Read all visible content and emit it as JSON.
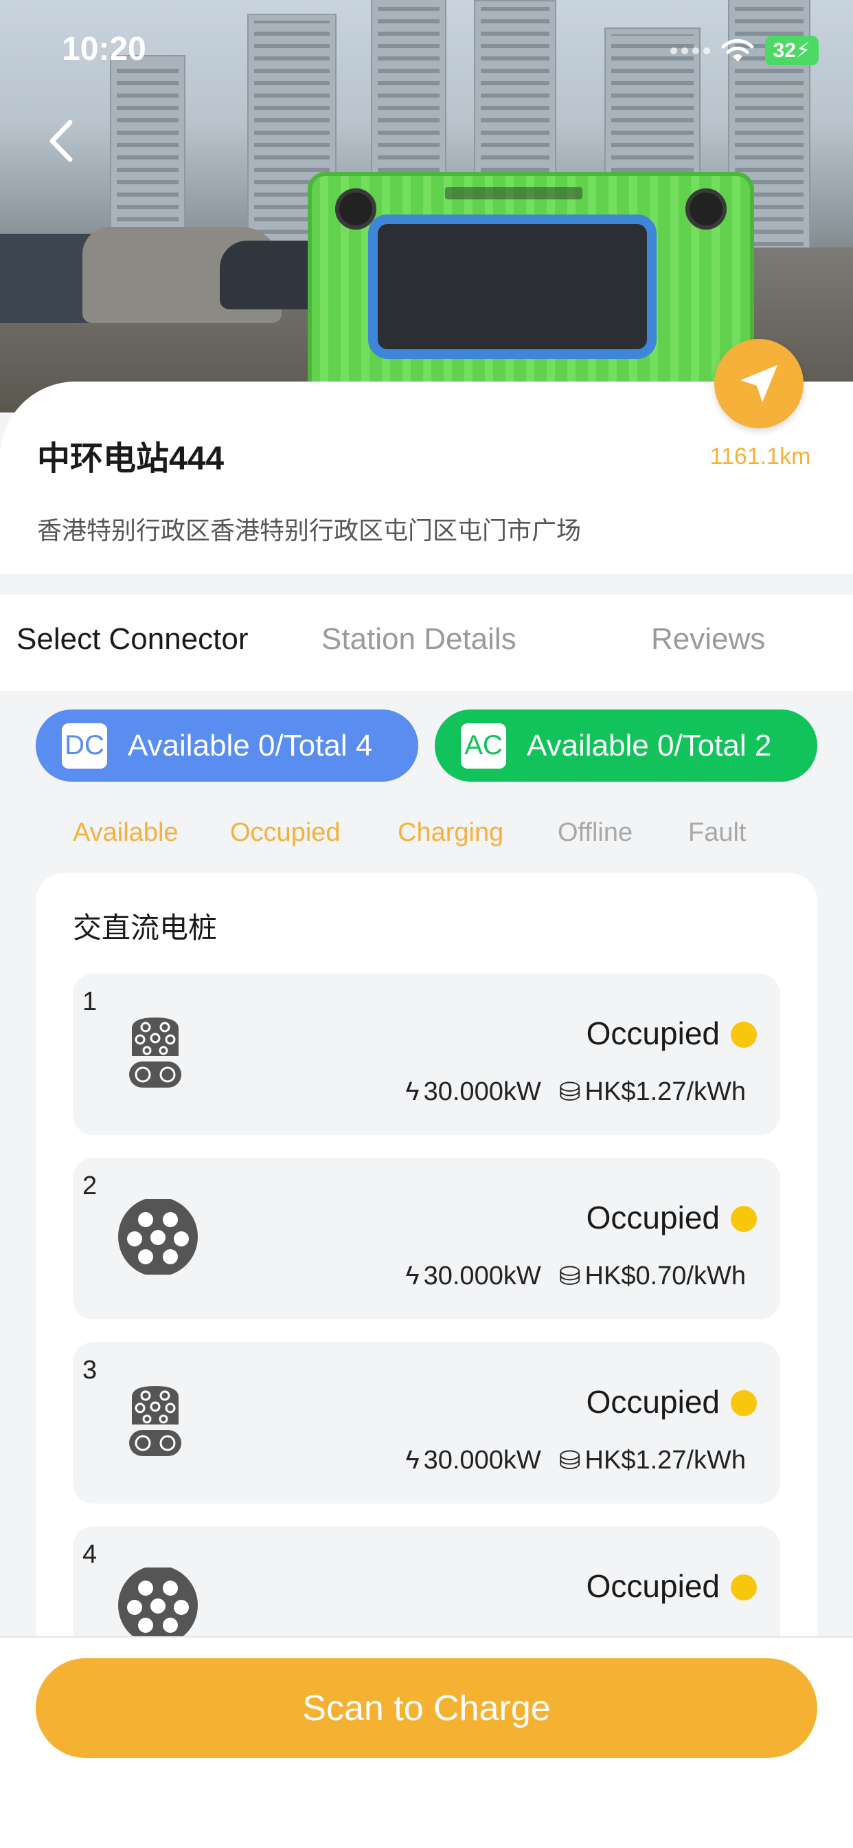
{
  "status_bar": {
    "time": "10:20",
    "battery": "32"
  },
  "station": {
    "name": "中环电站444",
    "address": "香港特别行政区香港特别行政区屯门区屯门市广场",
    "distance": "1161.1km"
  },
  "tabs": [
    {
      "label": "Select Connector",
      "active": true
    },
    {
      "label": "Station Details",
      "active": false
    },
    {
      "label": "Reviews",
      "active": false
    }
  ],
  "summary": {
    "dc": {
      "badge": "DC",
      "text": "Available 0/Total 4",
      "color": "#5a8df0"
    },
    "ac": {
      "badge": "AC",
      "text": "Available 0/Total 2",
      "color": "#12c25a"
    }
  },
  "filters": [
    {
      "label": "Available",
      "active": true
    },
    {
      "label": "Occupied",
      "active": true
    },
    {
      "label": "Charging",
      "active": true
    },
    {
      "label": "Offline",
      "active": false
    },
    {
      "label": "Fault",
      "active": false
    }
  ],
  "list": {
    "title": "交直流电桩",
    "connectors": [
      {
        "number": "1",
        "plug_icon": "ccs-dc-plug-icon",
        "status": "Occupied",
        "status_color": "#f8c60c",
        "power": "30.000kW",
        "price": "HK$1.27/kWh"
      },
      {
        "number": "2",
        "plug_icon": "type2-ac-plug-icon",
        "status": "Occupied",
        "status_color": "#f8c60c",
        "power": "30.000kW",
        "price": "HK$0.70/kWh"
      },
      {
        "number": "3",
        "plug_icon": "ccs-dc-plug-icon",
        "status": "Occupied",
        "status_color": "#f8c60c",
        "power": "30.000kW",
        "price": "HK$1.27/kWh"
      },
      {
        "number": "4",
        "plug_icon": "type2-ac-plug-icon",
        "status": "Occupied",
        "status_color": "#f8c60c"
      }
    ]
  },
  "actions": {
    "scan_label": "Scan to Charge"
  },
  "colors": {
    "accent": "#f5b13a",
    "dc": "#5a8df0",
    "ac": "#12c25a",
    "occupied": "#f8c60c"
  }
}
